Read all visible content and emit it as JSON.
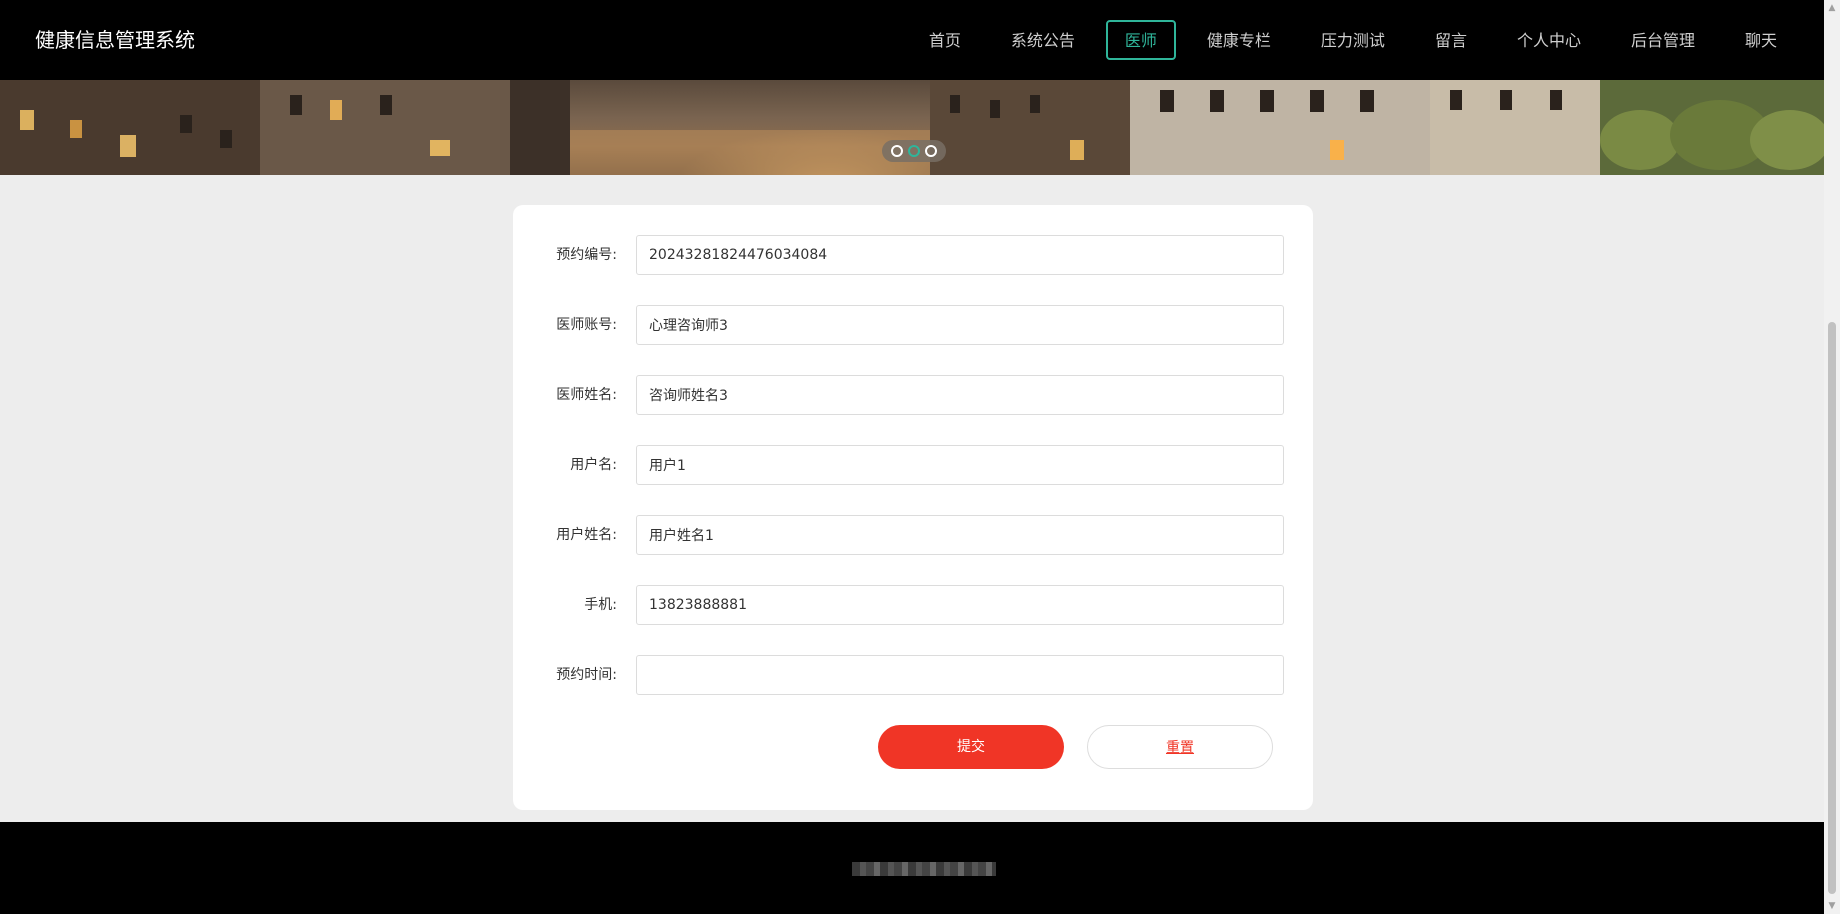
{
  "app": {
    "title": "健康信息管理系统"
  },
  "nav": {
    "items": [
      {
        "label": "首页"
      },
      {
        "label": "系统公告"
      },
      {
        "label": "医师"
      },
      {
        "label": "健康专栏"
      },
      {
        "label": "压力测试"
      },
      {
        "label": "留言"
      },
      {
        "label": "个人中心"
      },
      {
        "label": "后台管理"
      },
      {
        "label": "聊天"
      }
    ],
    "active_index": 2
  },
  "banner": {
    "active_dot": 2,
    "dot_count": 3
  },
  "form": {
    "fields": [
      {
        "label": "预约编号:",
        "value": "20243281824476034084",
        "placeholder": ""
      },
      {
        "label": "医师账号:",
        "value": "心理咨询师3",
        "placeholder": ""
      },
      {
        "label": "医师姓名:",
        "value": "咨询师姓名3",
        "placeholder": ""
      },
      {
        "label": "用户名:",
        "value": "用户1",
        "placeholder": ""
      },
      {
        "label": "用户姓名:",
        "value": "用户姓名1",
        "placeholder": ""
      },
      {
        "label": "手机:",
        "value": "13823888881",
        "placeholder": ""
      },
      {
        "label": "预约时间:",
        "value": "",
        "placeholder": ""
      }
    ],
    "submit_label": "提交",
    "reset_label": "重置"
  },
  "colors": {
    "accent": "#2fb59a",
    "primary_button": "#f03526",
    "topbar": "#000000"
  }
}
